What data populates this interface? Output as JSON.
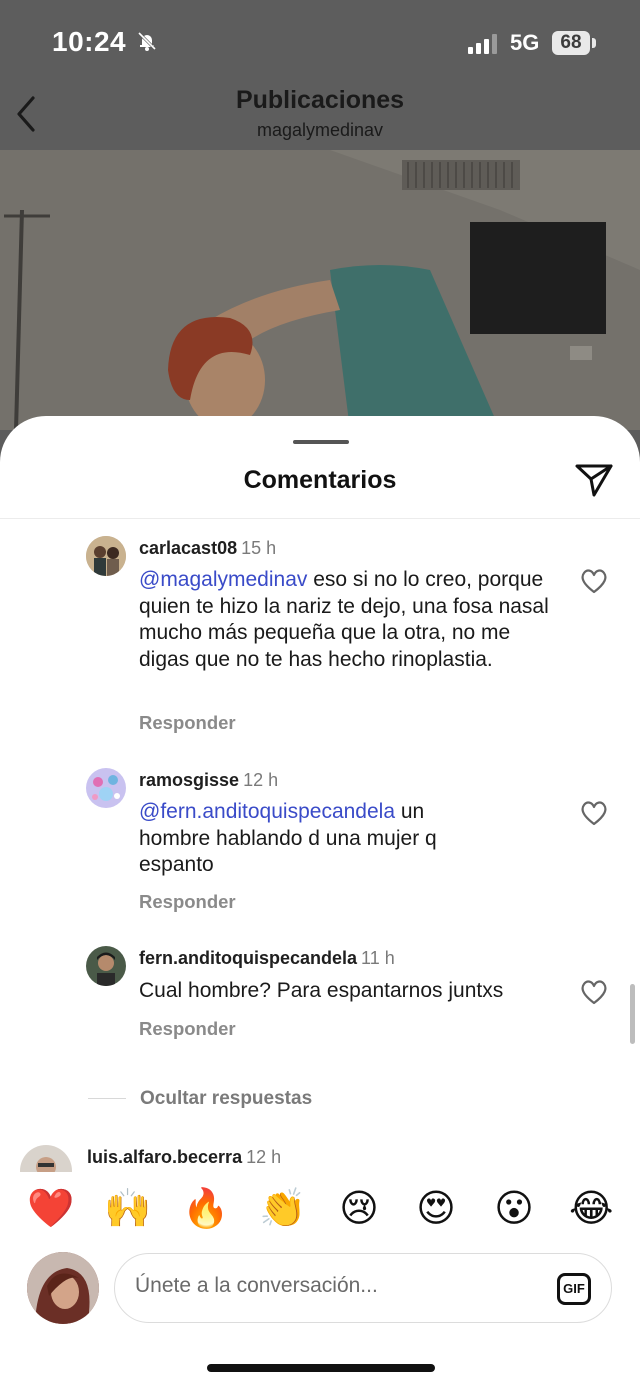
{
  "status_bar": {
    "time": "10:24",
    "network": "5G",
    "battery": "68"
  },
  "header": {
    "title": "Publicaciones",
    "subtitle": "magalymedinav"
  },
  "sheet": {
    "title": "Comentarios"
  },
  "comments": [
    {
      "username": "carlacast08",
      "time": "15 h",
      "mention": "@magalymedinav",
      "text": " eso si no lo creo, porque quien te hizo la nariz te dejo, una fosa nasal mucho más pequeña que la otra, no me digas que no te has hecho rinoplastia.",
      "reply_label": "Responder"
    },
    {
      "username": "ramosgisse",
      "time": "12 h",
      "mention": "@fern.anditoquispecandela",
      "text": "  un hombre hablando d una mujer q espanto",
      "reply_label": "Responder"
    },
    {
      "username": "fern.anditoquispecandela",
      "time": "11 h",
      "mention": "",
      "text": "Cual hombre? Para espantarnos juntxs",
      "reply_label": "Responder"
    }
  ],
  "hide_replies": "Ocultar respuestas",
  "next_comment": {
    "username": "luis.alfaro.becerra",
    "time": "12 h"
  },
  "emoji_reactions": [
    "❤️",
    "🙌",
    "🔥",
    "👏",
    "😢",
    "😍",
    "😮",
    "😂"
  ],
  "composer": {
    "placeholder": "Únete a la conversación...",
    "gif_label": "GIF"
  }
}
